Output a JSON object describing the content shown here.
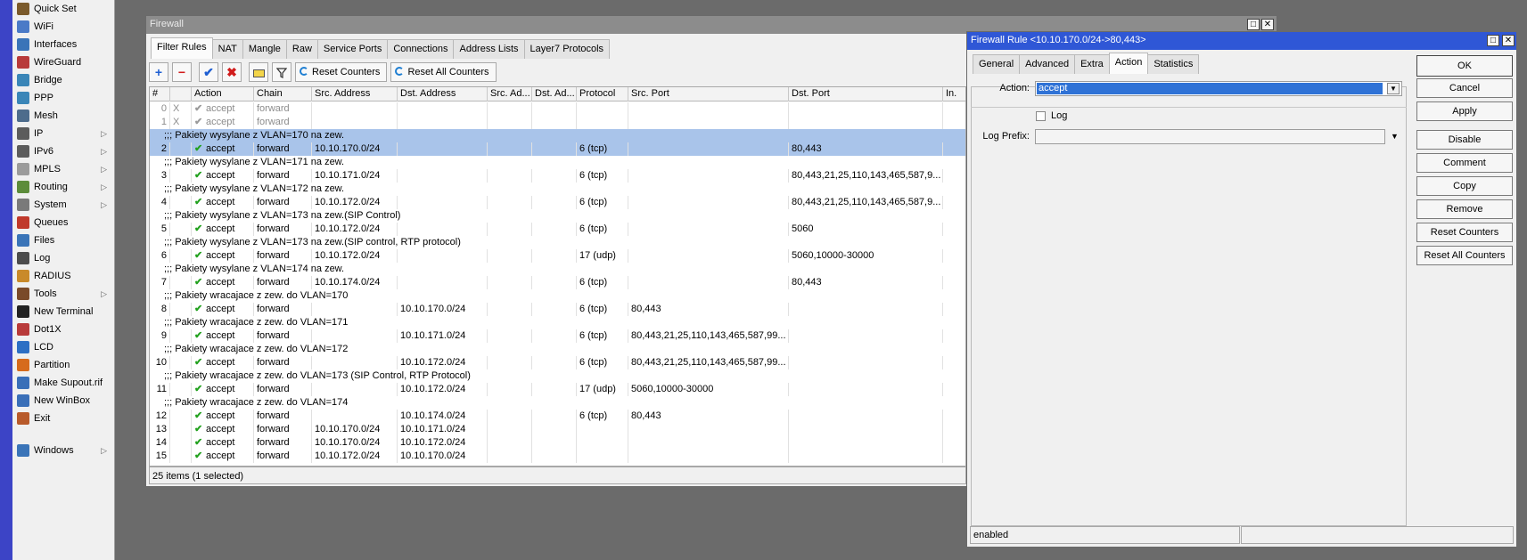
{
  "colors": {
    "accent": "#2f57d6",
    "selection": "#a9c4ea",
    "check": "#22a11e",
    "remove": "#d11c1c",
    "stripe": "#3c44c6"
  },
  "sidebar": {
    "items": [
      {
        "label": "Quick Set",
        "icon": "quick-set-icon",
        "arrow": false
      },
      {
        "label": "WiFi",
        "icon": "wifi-icon",
        "arrow": false
      },
      {
        "label": "Interfaces",
        "icon": "interfaces-icon",
        "arrow": false
      },
      {
        "label": "WireGuard",
        "icon": "wireguard-icon",
        "arrow": false
      },
      {
        "label": "Bridge",
        "icon": "bridge-icon",
        "arrow": false
      },
      {
        "label": "PPP",
        "icon": "ppp-icon",
        "arrow": false
      },
      {
        "label": "Mesh",
        "icon": "mesh-icon",
        "arrow": false
      },
      {
        "label": "IP",
        "icon": "ip-icon",
        "arrow": true
      },
      {
        "label": "IPv6",
        "icon": "ipv6-icon",
        "arrow": true
      },
      {
        "label": "MPLS",
        "icon": "mpls-icon",
        "arrow": true
      },
      {
        "label": "Routing",
        "icon": "routing-icon",
        "arrow": true
      },
      {
        "label": "System",
        "icon": "system-icon",
        "arrow": true
      },
      {
        "label": "Queues",
        "icon": "queues-icon",
        "arrow": false
      },
      {
        "label": "Files",
        "icon": "files-icon",
        "arrow": false
      },
      {
        "label": "Log",
        "icon": "log-icon",
        "arrow": false
      },
      {
        "label": "RADIUS",
        "icon": "radius-icon",
        "arrow": false
      },
      {
        "label": "Tools",
        "icon": "tools-icon",
        "arrow": true
      },
      {
        "label": "New Terminal",
        "icon": "terminal-icon",
        "arrow": false
      },
      {
        "label": "Dot1X",
        "icon": "dot1x-icon",
        "arrow": false
      },
      {
        "label": "LCD",
        "icon": "lcd-icon",
        "arrow": false
      },
      {
        "label": "Partition",
        "icon": "partition-icon",
        "arrow": false
      },
      {
        "label": "Make Supout.rif",
        "icon": "supout-icon",
        "arrow": false
      },
      {
        "label": "New WinBox",
        "icon": "winbox-icon",
        "arrow": false
      },
      {
        "label": "Exit",
        "icon": "exit-icon",
        "arrow": false
      }
    ],
    "windows": {
      "label": "Windows",
      "icon": "windows-icon",
      "arrow": true
    }
  },
  "firewall": {
    "title": "Firewall",
    "tabs": [
      "Filter Rules",
      "NAT",
      "Mangle",
      "Raw",
      "Service Ports",
      "Connections",
      "Address Lists",
      "Layer7 Protocols"
    ],
    "toolbar": {
      "add": "+",
      "remove": "−",
      "enable": "✔",
      "disable": "✖",
      "comment": "",
      "filter": "",
      "reset_counters": "Reset Counters",
      "reset_all_counters": "Reset All Counters"
    },
    "columns": [
      "#",
      "Action",
      "Chain",
      "Src. Address",
      "Dst. Address",
      "Src. Ad...",
      "Dst. Ad...",
      "Protocol",
      "Src. Port",
      "Dst. Port",
      "In."
    ],
    "rows": [
      {
        "type": "rule",
        "num": "0",
        "flag": "X",
        "action": "accept",
        "chain": "forward",
        "src": "",
        "dst": "",
        "proto": "",
        "sport": "",
        "dport": "",
        "disabled": true
      },
      {
        "type": "rule",
        "num": "1",
        "flag": "X",
        "action": "accept",
        "chain": "forward",
        "src": "",
        "dst": "",
        "proto": "",
        "sport": "",
        "dport": "",
        "disabled": true
      },
      {
        "type": "comment",
        "text": ";;; Pakiety wysylane z VLAN=170 na zew.",
        "selected": true
      },
      {
        "type": "rule",
        "num": "2",
        "flag": "",
        "action": "accept",
        "chain": "forward",
        "src": "10.10.170.0/24",
        "dst": "",
        "proto": "6 (tcp)",
        "sport": "",
        "dport": "80,443",
        "selected": true
      },
      {
        "type": "comment",
        "text": ";;; Pakiety wysylane z VLAN=171 na zew."
      },
      {
        "type": "rule",
        "num": "3",
        "flag": "",
        "action": "accept",
        "chain": "forward",
        "src": "10.10.171.0/24",
        "dst": "",
        "proto": "6 (tcp)",
        "sport": "",
        "dport": "80,443,21,25,110,143,465,587,9..."
      },
      {
        "type": "comment",
        "text": ";;; Pakiety wysylane z VLAN=172 na zew."
      },
      {
        "type": "rule",
        "num": "4",
        "flag": "",
        "action": "accept",
        "chain": "forward",
        "src": "10.10.172.0/24",
        "dst": "",
        "proto": "6 (tcp)",
        "sport": "",
        "dport": "80,443,21,25,110,143,465,587,9..."
      },
      {
        "type": "comment",
        "text": ";;; Pakiety wysylane z VLAN=173 na zew.(SIP Control)"
      },
      {
        "type": "rule",
        "num": "5",
        "flag": "",
        "action": "accept",
        "chain": "forward",
        "src": "10.10.172.0/24",
        "dst": "",
        "proto": "6 (tcp)",
        "sport": "",
        "dport": "5060"
      },
      {
        "type": "comment",
        "text": ";;; Pakiety wysylane z VLAN=173 na zew.(SIP control, RTP protocol)"
      },
      {
        "type": "rule",
        "num": "6",
        "flag": "",
        "action": "accept",
        "chain": "forward",
        "src": "10.10.172.0/24",
        "dst": "",
        "proto": "17 (udp)",
        "sport": "",
        "dport": "5060,10000-30000"
      },
      {
        "type": "comment",
        "text": ";;; Pakiety wysylane z VLAN=174 na zew."
      },
      {
        "type": "rule",
        "num": "7",
        "flag": "",
        "action": "accept",
        "chain": "forward",
        "src": "10.10.174.0/24",
        "dst": "",
        "proto": "6 (tcp)",
        "sport": "",
        "dport": "80,443"
      },
      {
        "type": "comment",
        "text": ";;; Pakiety wracajace z zew. do VLAN=170"
      },
      {
        "type": "rule",
        "num": "8",
        "flag": "",
        "action": "accept",
        "chain": "forward",
        "src": "",
        "dst": "10.10.170.0/24",
        "proto": "6 (tcp)",
        "sport": "80,443",
        "dport": ""
      },
      {
        "type": "comment",
        "text": ";;; Pakiety wracajace z zew. do VLAN=171"
      },
      {
        "type": "rule",
        "num": "9",
        "flag": "",
        "action": "accept",
        "chain": "forward",
        "src": "",
        "dst": "10.10.171.0/24",
        "proto": "6 (tcp)",
        "sport": "80,443,21,25,110,143,465,587,99...",
        "dport": ""
      },
      {
        "type": "comment",
        "text": ";;; Pakiety wracajace z zew. do VLAN=172"
      },
      {
        "type": "rule",
        "num": "10",
        "flag": "",
        "action": "accept",
        "chain": "forward",
        "src": "",
        "dst": "10.10.172.0/24",
        "proto": "6 (tcp)",
        "sport": "80,443,21,25,110,143,465,587,99...",
        "dport": ""
      },
      {
        "type": "comment",
        "text": ";;; Pakiety wracajace z zew. do VLAN=173 (SIP Control, RTP Protocol)"
      },
      {
        "type": "rule",
        "num": "11",
        "flag": "",
        "action": "accept",
        "chain": "forward",
        "src": "",
        "dst": "10.10.172.0/24",
        "proto": "17 (udp)",
        "sport": "5060,10000-30000",
        "dport": ""
      },
      {
        "type": "comment",
        "text": ";;; Pakiety wracajace z zew. do VLAN=174"
      },
      {
        "type": "rule",
        "num": "12",
        "flag": "",
        "action": "accept",
        "chain": "forward",
        "src": "",
        "dst": "10.10.174.0/24",
        "proto": "6 (tcp)",
        "sport": "80,443",
        "dport": ""
      },
      {
        "type": "rule",
        "num": "13",
        "flag": "",
        "action": "accept",
        "chain": "forward",
        "src": "10.10.170.0/24",
        "dst": "10.10.171.0/24",
        "proto": "",
        "sport": "",
        "dport": ""
      },
      {
        "type": "rule",
        "num": "14",
        "flag": "",
        "action": "accept",
        "chain": "forward",
        "src": "10.10.170.0/24",
        "dst": "10.10.172.0/24",
        "proto": "",
        "sport": "",
        "dport": ""
      },
      {
        "type": "rule",
        "num": "15",
        "flag": "",
        "action": "accept",
        "chain": "forward",
        "src": "10.10.172.0/24",
        "dst": "10.10.170.0/24",
        "proto": "",
        "sport": "",
        "dport": ""
      }
    ],
    "footer": "25 items (1 selected)"
  },
  "rule_dialog": {
    "title": "Firewall Rule <10.10.170.0/24->80,443>",
    "tabs": [
      "General",
      "Advanced",
      "Extra",
      "Action",
      "Statistics"
    ],
    "selected_tab": "Action",
    "action_label": "Action:",
    "action_value": "accept",
    "log_label": "Log",
    "log_checked": false,
    "log_prefix_label": "Log Prefix:",
    "log_prefix_value": "",
    "buttons": [
      "OK",
      "Cancel",
      "Apply",
      "Disable",
      "Comment",
      "Copy",
      "Remove",
      "Reset Counters",
      "Reset All Counters"
    ],
    "status": "enabled"
  }
}
